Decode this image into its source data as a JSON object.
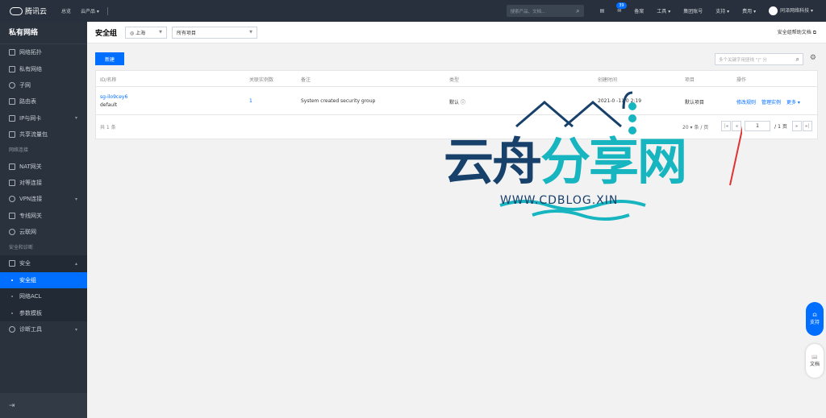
{
  "topbar": {
    "logo": "腾讯云",
    "nav": [
      "总览",
      "云产品 ▾"
    ],
    "search_placeholder": "搜索产品、文档...",
    "badge": "39",
    "items": [
      "备案",
      "工具 ▾",
      "集团账号",
      "支持 ▾",
      "费用 ▾"
    ],
    "user": "同泽网络科技 ▾"
  },
  "sidebar": {
    "title": "私有网络",
    "items": [
      {
        "label": "网络拓扑",
        "icon": "topology-icon"
      },
      {
        "label": "私有网络",
        "icon": "vpc-icon"
      },
      {
        "label": "子网",
        "icon": "subnet-icon"
      },
      {
        "label": "路由表",
        "icon": "route-table-icon"
      },
      {
        "label": "IP与网卡",
        "icon": "ip-icon",
        "caret": "▾"
      },
      {
        "label": "共享流量包",
        "icon": "traffic-icon"
      }
    ],
    "group_conn": "网络连接",
    "conn_items": [
      {
        "label": "NAT网关",
        "icon": "nat-icon"
      },
      {
        "label": "对等连接",
        "icon": "peering-icon"
      },
      {
        "label": "VPN连接",
        "icon": "vpn-icon",
        "caret": "▾"
      },
      {
        "label": "专线网关",
        "icon": "gateway-icon"
      },
      {
        "label": "云联网",
        "icon": "ccn-icon"
      }
    ],
    "group_sec": "安全和诊断",
    "sec_item": {
      "label": "安全",
      "icon": "shield-icon",
      "caret": "▴"
    },
    "sec_subs": [
      "安全组",
      "网络ACL",
      "参数模板"
    ],
    "diag_item": {
      "label": "诊断工具",
      "icon": "diagnose-icon",
      "caret": "▾"
    }
  },
  "header": {
    "title": "安全组",
    "region": "上海",
    "project": "所有项目",
    "doc_link": "安全组帮助文档"
  },
  "toolbar": {
    "new_button": "新建",
    "search_placeholder": "多个关键字用竖线 \"|\" 分"
  },
  "table": {
    "columns": [
      "ID/名称",
      "关联实例数",
      "备注",
      "类型",
      "创建时间",
      "项目",
      "操作"
    ],
    "rows": [
      {
        "id": "sg-ilo9cey6",
        "name": "default",
        "instances": "1",
        "remark": "System created security group",
        "type": "默认",
        "created": "2021-0 -11 0 2:19",
        "project": "默认项目",
        "actions": [
          "修改规则",
          "管理实例",
          "更多 ▾"
        ]
      }
    ],
    "total": "共 1 条",
    "page_size": "20 ▾ 条 / 页",
    "page": "1",
    "page_total": "/ 1 页"
  },
  "watermark": {
    "text_dark": "云舟",
    "text_cyan": "分享网",
    "url": "WWW.CDBLOG.XIN"
  },
  "float": {
    "support": "支持",
    "docs": "文档"
  }
}
